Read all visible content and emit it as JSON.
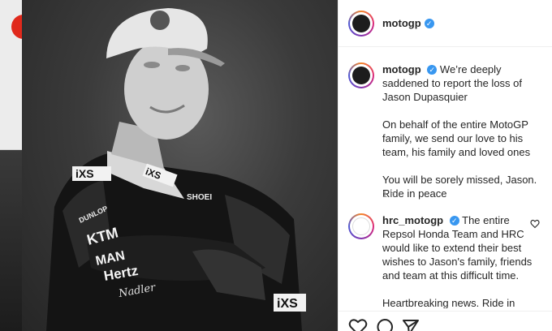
{
  "post": {
    "username": "motogp",
    "verified_mark": "✓",
    "caption_lines": [
      "We’re deeply saddened to report the loss of Jason Dupasquier",
      "On behalf of the entire MotoGP family, we send our love to his team, his family and loved ones",
      "You will be sorely missed, Jason. Ride in peace"
    ],
    "time_ago": "1 h"
  },
  "comment": {
    "username": "hrc_motogp",
    "verified_mark": "✓",
    "lines": [
      "The entire Repsol Honda Team and HRC would like to extend their best wishes to Jason's family, friends and team at this difficult time.",
      "Heartbreaking news. Ride in peace"
    ]
  },
  "photo": {
    "logos": [
      "iXS",
      "iXS",
      "SHOEI",
      "DUNLOP",
      "KTM",
      "MAN",
      "Hertz",
      "Nadler",
      "iXS"
    ]
  },
  "icons": {
    "like": "heart-icon",
    "comment": "comment-icon",
    "share": "share-icon",
    "comment_like": "heart-icon"
  },
  "colors": {
    "verified": "#3897f0",
    "text": "#262626",
    "muted": "#8e8e8e"
  }
}
